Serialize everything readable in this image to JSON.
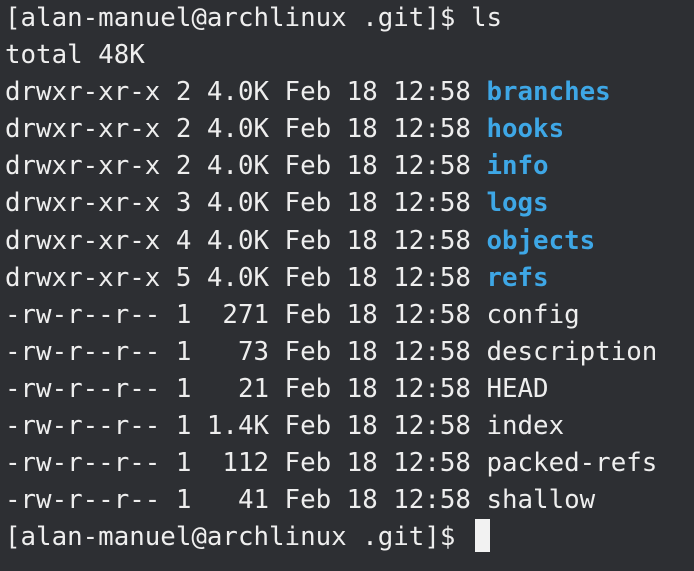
{
  "colors": {
    "background": "#2d2f33",
    "text": "#eeeeee",
    "directory": "#3ea7e6",
    "cursor": "#f2f2f2"
  },
  "prompt": "[alan-manuel@archlinux .git]$",
  "command": "ls",
  "total_line": "total 48K",
  "entries": [
    {
      "meta": "drwxr-xr-x 2 4.0K Feb 18 12:58 ",
      "name": "branches",
      "is_dir": true
    },
    {
      "meta": "drwxr-xr-x 2 4.0K Feb 18 12:58 ",
      "name": "hooks",
      "is_dir": true
    },
    {
      "meta": "drwxr-xr-x 2 4.0K Feb 18 12:58 ",
      "name": "info",
      "is_dir": true
    },
    {
      "meta": "drwxr-xr-x 3 4.0K Feb 18 12:58 ",
      "name": "logs",
      "is_dir": true
    },
    {
      "meta": "drwxr-xr-x 4 4.0K Feb 18 12:58 ",
      "name": "objects",
      "is_dir": true
    },
    {
      "meta": "drwxr-xr-x 5 4.0K Feb 18 12:58 ",
      "name": "refs",
      "is_dir": true
    },
    {
      "meta": "-rw-r--r-- 1  271 Feb 18 12:58 ",
      "name": "config",
      "is_dir": false
    },
    {
      "meta": "-rw-r--r-- 1   73 Feb 18 12:58 ",
      "name": "description",
      "is_dir": false
    },
    {
      "meta": "-rw-r--r-- 1   21 Feb 18 12:58 ",
      "name": "HEAD",
      "is_dir": false
    },
    {
      "meta": "-rw-r--r-- 1 1.4K Feb 18 12:58 ",
      "name": "index",
      "is_dir": false
    },
    {
      "meta": "-rw-r--r-- 1  112 Feb 18 12:58 ",
      "name": "packed-refs",
      "is_dir": false
    },
    {
      "meta": "-rw-r--r-- 1   41 Feb 18 12:58 ",
      "name": "shallow",
      "is_dir": false
    }
  ],
  "final_prompt": "[alan-manuel@archlinux .git]$ "
}
